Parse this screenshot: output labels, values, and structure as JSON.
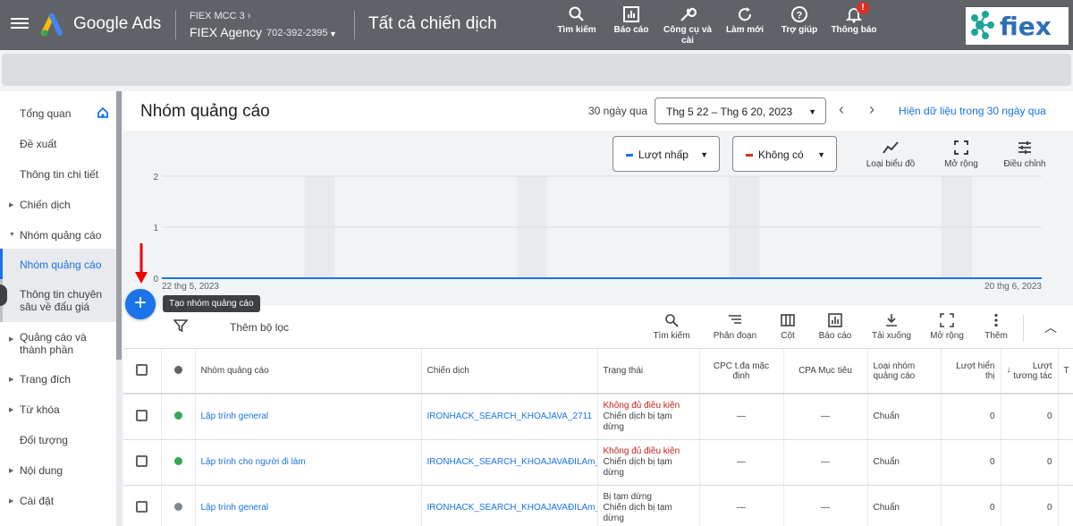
{
  "topbar": {
    "app_title": "Google Ads",
    "account_line1": "FIEX MCC 3",
    "account_name": "FIEX Agency",
    "account_id": "702-392-2395",
    "page_context": "Tất cả chiến dịch",
    "tools": [
      {
        "label": "Tìm kiếm",
        "icon": "search-icon"
      },
      {
        "label": "Báo cáo",
        "icon": "reports-icon"
      },
      {
        "label": "Công cụ và cài",
        "icon": "wrench-icon"
      },
      {
        "label": "Làm mới",
        "icon": "refresh-icon"
      },
      {
        "label": "Trợ giúp",
        "icon": "help-icon"
      },
      {
        "label": "Thông báo",
        "icon": "bell-icon"
      }
    ],
    "notification_badge": "!",
    "brand_logo": "fiex"
  },
  "sidebar": {
    "items": [
      {
        "label": "Tổng quan"
      },
      {
        "label": "Đề xuất"
      },
      {
        "label": "Thông tin chi tiết"
      },
      {
        "label": "Chiến dịch"
      },
      {
        "label": "Nhóm quảng cáo"
      },
      {
        "label": "Nhóm quảng cáo"
      },
      {
        "label": "Thông tin chuyên sâu về đấu giá"
      },
      {
        "label": "Quảng cáo và thành phần"
      },
      {
        "label": "Trang đích"
      },
      {
        "label": "Từ khóa"
      },
      {
        "label": "Đối tượng"
      },
      {
        "label": "Nội dung"
      },
      {
        "label": "Cài đặt"
      }
    ]
  },
  "main": {
    "title": "Nhóm quảng cáo",
    "date_label": "30 ngày qua",
    "date_range": "Thg 5 22 – Thg 6 20, 2023",
    "show_30_link": "Hiện dữ liệu trong 30 ngày qua",
    "metric1": "Lượt nhấp",
    "metric2": "Không có",
    "chart_tools": [
      "Loại biểu đồ",
      "Mở rộng",
      "Điều chỉnh"
    ],
    "fab_tooltip": "Tạo nhóm quảng cáo",
    "add_filter": "Thêm bộ lọc",
    "table_tools": [
      "Tìm kiếm",
      "Phân đoạn",
      "Cột",
      "Báo cáo",
      "Tải xuống",
      "Mở rộng",
      "Thêm"
    ]
  },
  "chart_data": {
    "type": "line",
    "x_start_label": "22 thg 5, 2023",
    "x_end_label": "20 thg 6, 2023",
    "y_ticks": [
      "2",
      "1",
      "0"
    ],
    "ylim": [
      0,
      2
    ],
    "series": [
      {
        "name": "Lượt nhấp",
        "values": [
          0,
          0
        ]
      }
    ],
    "colors": {
      "series": "#1a73e8",
      "weekend": "#e8eaed"
    }
  },
  "table": {
    "headers": [
      "Nhóm quảng cáo",
      "Chiến dịch",
      "Trạng thái",
      "CPC t.đa mặc định",
      "CPA Mục tiêu",
      "Loại nhóm quảng cáo",
      "Lượt hiển thị",
      "Lượt tương tác",
      "T"
    ],
    "rows": [
      {
        "name": "Lập trình general",
        "campaign": "IRONHACK_SEARCH_KHOAJAVA_2711",
        "status1": "Không đủ điều kiện",
        "status2": "Chiến dịch bị tạm dừng",
        "cpc": "—",
        "cpa": "—",
        "type": "Chuẩn",
        "impr": "0",
        "inter": "0",
        "dot": "#34a853"
      },
      {
        "name": "Lập trình cho người đi làm",
        "campaign": "IRONHACK_SEARCH_KHOAJAVAĐILAm_",
        "status1": "Không đủ điều kiện",
        "status2": "Chiến dịch bị tạm dừng",
        "cpc": "—",
        "cpa": "—",
        "type": "Chuẩn",
        "impr": "0",
        "inter": "0",
        "dot": "#34a853"
      },
      {
        "name": "Lập trình general",
        "campaign": "IRONHACK_SEARCH_KHOAJAVAĐILAm_",
        "status1": "Bị tạm dừng",
        "status2": "Chiến dịch bị tạm dừng",
        "cpc": "—",
        "cpa": "—",
        "type": "Chuẩn",
        "impr": "0",
        "inter": "0",
        "dot": "#80868b"
      }
    ]
  }
}
